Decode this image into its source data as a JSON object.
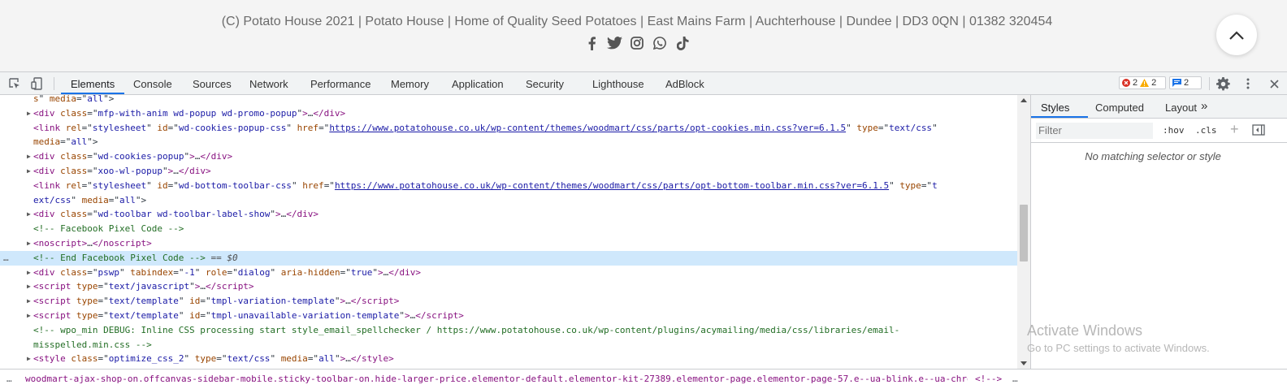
{
  "site_footer": {
    "copyright": "(C) Potato House 2021 | Potato House | Home of Quality Seed Potatoes | East Mains Farm | Auchterhouse | Dundee | DD3 0QN | 01382 320454",
    "social_icons": [
      "facebook-icon",
      "twitter-icon",
      "instagram-icon",
      "whatsapp-icon",
      "tiktok-icon"
    ],
    "scroll_top_icon": "chevron-up-icon"
  },
  "devtools": {
    "tabs": [
      "Elements",
      "Console",
      "Sources",
      "Network",
      "Performance",
      "Memory",
      "Application",
      "Security",
      "Lighthouse",
      "AdBlock"
    ],
    "active_tab": "Elements",
    "errors": "2",
    "warnings": "2",
    "messages": "2",
    "accent": "#1a73e8"
  },
  "elements": {
    "lines": [
      {
        "tri": "",
        "html": "<span class=\"a\">s</span><span class=\"p\">\" </span><span class=\"a\">media</span><span class=\"p\">=\"</span><span class=\"v\">all</span><span class=\"p\">\"&gt;</span>"
      },
      {
        "tri": "▶",
        "html": "<span class=\"t\">&lt;div </span><span class=\"a\">class</span><span class=\"p\">=\"</span><span class=\"v\">mfp-with-anim wd-popup wd-promo-popup</span><span class=\"p\">\"</span><span class=\"t\">&gt;</span><span class=\"p\">…</span><span class=\"t\">&lt;/div&gt;</span>"
      },
      {
        "tri": "",
        "html": "<span class=\"t\">&lt;link </span><span class=\"a\">rel</span><span class=\"p\">=\"</span><span class=\"v\">stylesheet</span><span class=\"p\">\" </span><span class=\"a\">id</span><span class=\"p\">=\"</span><span class=\"v\">wd-cookies-popup-css</span><span class=\"p\">\" </span><span class=\"a\">href</span><span class=\"p\">=\"</span><span class=\"l\">https://www.potatohouse.co.uk/wp-content/themes/woodmart/css/parts/opt-cookies.min.css?ver=6.1.5</span><span class=\"p\">\" </span><span class=\"a\">type</span><span class=\"p\">=\"</span><span class=\"v\">text/css</span><span class=\"p\">\"</span>"
      },
      {
        "tri": "",
        "html": "<span class=\"a\">media</span><span class=\"p\">=\"</span><span class=\"v\">all</span><span class=\"p\">\"&gt;</span>"
      },
      {
        "tri": "▶",
        "html": "<span class=\"t\">&lt;div </span><span class=\"a\">class</span><span class=\"p\">=\"</span><span class=\"v\">wd-cookies-popup</span><span class=\"p\">\"</span><span class=\"t\">&gt;</span><span class=\"p\">…</span><span class=\"t\">&lt;/div&gt;</span>"
      },
      {
        "tri": "▶",
        "html": "<span class=\"t\">&lt;div </span><span class=\"a\">class</span><span class=\"p\">=\"</span><span class=\"v\">xoo-wl-popup</span><span class=\"p\">\"</span><span class=\"t\">&gt;</span><span class=\"p\">…</span><span class=\"t\">&lt;/div&gt;</span>"
      },
      {
        "tri": "",
        "html": "<span class=\"t\">&lt;link </span><span class=\"a\">rel</span><span class=\"p\">=\"</span><span class=\"v\">stylesheet</span><span class=\"p\">\" </span><span class=\"a\">id</span><span class=\"p\">=\"</span><span class=\"v\">wd-bottom-toolbar-css</span><span class=\"p\">\" </span><span class=\"a\">href</span><span class=\"p\">=\"</span><span class=\"l\">https://www.potatohouse.co.uk/wp-content/themes/woodmart/css/parts/opt-bottom-toolbar.min.css?ver=6.1.5</span><span class=\"p\">\" </span><span class=\"a\">type</span><span class=\"p\">=\"</span><span class=\"v\">t</span>"
      },
      {
        "tri": "",
        "html": "<span class=\"v\">ext/css</span><span class=\"p\">\" </span><span class=\"a\">media</span><span class=\"p\">=\"</span><span class=\"v\">all</span><span class=\"p\">\"&gt;</span>"
      },
      {
        "tri": "▶",
        "html": "<span class=\"t\">&lt;div </span><span class=\"a\">class</span><span class=\"p\">=\"</span><span class=\"v\">wd-toolbar wd-toolbar-label-show</span><span class=\"p\">\"</span><span class=\"t\">&gt;</span><span class=\"p\">…</span><span class=\"t\">&lt;/div&gt;</span>"
      },
      {
        "tri": "",
        "html": "<span class=\"c\">&lt;!-- Facebook Pixel Code --&gt;</span>"
      },
      {
        "tri": "▶",
        "html": "<span class=\"t\">&lt;noscript&gt;</span><span class=\"p\">…</span><span class=\"t\">&lt;/noscript&gt;</span>"
      },
      {
        "tri": "",
        "dots": "…",
        "selected": true,
        "html": "<span class=\"c\">&lt;!-- End Facebook Pixel Code --&gt;</span><span class=\"eq\"> == $0</span>"
      },
      {
        "tri": "▶",
        "html": "<span class=\"t\">&lt;div </span><span class=\"a\">class</span><span class=\"p\">=\"</span><span class=\"v\">pswp</span><span class=\"p\">\" </span><span class=\"a\">tabindex</span><span class=\"p\">=\"</span><span class=\"v\">-1</span><span class=\"p\">\" </span><span class=\"a\">role</span><span class=\"p\">=\"</span><span class=\"v\">dialog</span><span class=\"p\">\" </span><span class=\"a\">aria-hidden</span><span class=\"p\">=\"</span><span class=\"v\">true</span><span class=\"p\">\"</span><span class=\"t\">&gt;</span><span class=\"p\">…</span><span class=\"t\">&lt;/div&gt;</span>"
      },
      {
        "tri": "▶",
        "html": "<span class=\"t\">&lt;script </span><span class=\"a\">type</span><span class=\"p\">=\"</span><span class=\"v\">text/javascript</span><span class=\"p\">\"</span><span class=\"t\">&gt;</span><span class=\"p\">…</span><span class=\"t\">&lt;/script&gt;</span>"
      },
      {
        "tri": "▶",
        "html": "<span class=\"t\">&lt;script </span><span class=\"a\">type</span><span class=\"p\">=\"</span><span class=\"v\">text/template</span><span class=\"p\">\" </span><span class=\"a\">id</span><span class=\"p\">=\"</span><span class=\"v\">tmpl-variation-template</span><span class=\"p\">\"</span><span class=\"t\">&gt;</span><span class=\"p\">…</span><span class=\"t\">&lt;/script&gt;</span>"
      },
      {
        "tri": "▶",
        "html": "<span class=\"t\">&lt;script </span><span class=\"a\">type</span><span class=\"p\">=\"</span><span class=\"v\">text/template</span><span class=\"p\">\" </span><span class=\"a\">id</span><span class=\"p\">=\"</span><span class=\"v\">tmpl-unavailable-variation-template</span><span class=\"p\">\"</span><span class=\"t\">&gt;</span><span class=\"p\">…</span><span class=\"t\">&lt;/script&gt;</span>"
      },
      {
        "tri": "",
        "html": "<span class=\"c\">&lt;!-- wpo_min DEBUG: Inline CSS processing start style_email_spellchecker / https://www.potatohouse.co.uk/wp-content/plugins/acymailing/media/css/libraries/email-</span>"
      },
      {
        "tri": "",
        "html": "<span class=\"c\">misspelled.min.css --&gt;</span>"
      },
      {
        "tri": "▶",
        "html": "<span class=\"t\">&lt;style </span><span class=\"a\">class</span><span class=\"p\">=\"</span><span class=\"v\">optimize_css_2</span><span class=\"p\">\" </span><span class=\"a\">type</span><span class=\"p\">=\"</span><span class=\"v\">text/css</span><span class=\"p\">\" </span><span class=\"a\">media</span><span class=\"p\">=\"</span><span class=\"v\">all</span><span class=\"p\">\"</span><span class=\"t\">&gt;</span><span class=\"p\">…</span><span class=\"t\">&lt;/style&gt;</span>"
      }
    ]
  },
  "styles_pane": {
    "tabs": [
      "Styles",
      "Computed",
      "Layout"
    ],
    "more": "»",
    "filter_placeholder": "Filter",
    "hov": ":hov",
    "cls": ".cls",
    "add": "+",
    "no_match": "No matching selector or style"
  },
  "watermark": {
    "title": "Activate Windows",
    "subtitle": "Go to PC settings to activate Windows."
  },
  "breadcrumb": {
    "ellipsis": "…",
    "path": "woodmart-ajax-shop-on.offcanvas-sidebar-mobile.sticky-toolbar-on.hide-larger-price.elementor-default.elementor-kit-27389.elementor-page.elementor-page-57.e--ua-blink.e--ua-chrome.e--ua-webkit",
    "comment": "<!--> ",
    "more": "…"
  }
}
